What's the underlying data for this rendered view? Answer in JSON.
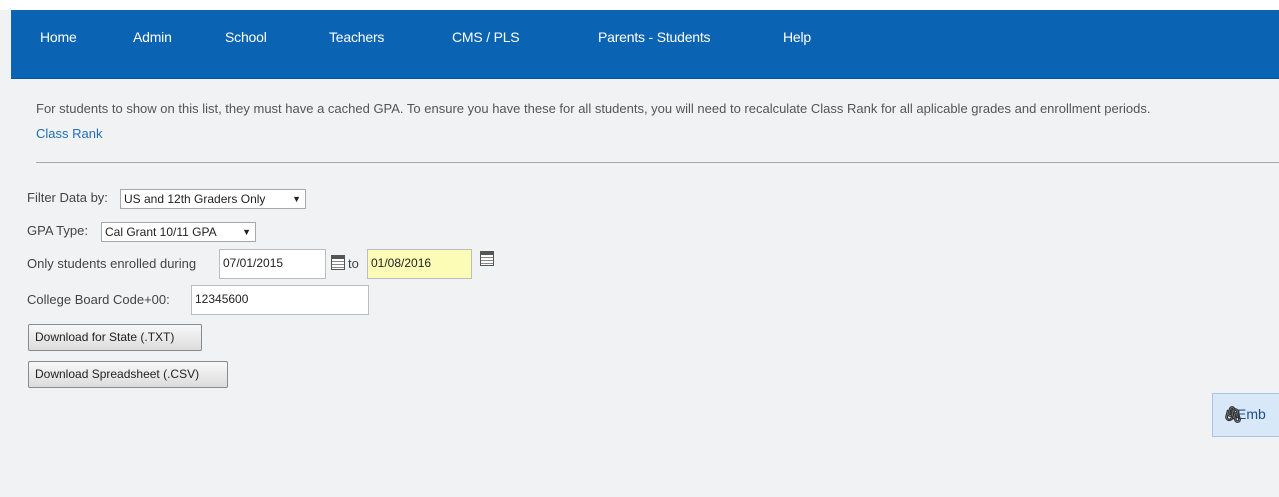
{
  "nav": {
    "items": [
      {
        "label": "Home"
      },
      {
        "label": "Admin"
      },
      {
        "label": "School"
      },
      {
        "label": "Teachers"
      },
      {
        "label": "CMS / PLS"
      },
      {
        "label": "Parents - Students"
      },
      {
        "label": "Help"
      }
    ]
  },
  "notice": {
    "text": "For students to show on this list, they must have a cached GPA. To ensure you have these for all students, you will need to recalculate Class Rank for all aplicable grades and enrollment periods.",
    "link_label": "Class Rank"
  },
  "filters": {
    "filter_label": "Filter Data by:",
    "filter_value": "US and 12th Graders Only",
    "gpa_type_label": "GPA Type:",
    "gpa_type_value": "Cal Grant 10/11 GPA",
    "enrolled_label": "Only students enrolled during",
    "start_date": "07/01/2015",
    "to_label": "to",
    "end_date": "01/08/2016",
    "college_board_label": "College Board Code+00:",
    "college_board_value": "12345600"
  },
  "buttons": {
    "download_state": "Download for State (.TXT)",
    "download_csv": "Download Spreadsheet (.CSV)",
    "embed": "Emb"
  },
  "icons": {
    "dropdown_arrow": "▼",
    "paperclip": "paperclip-icon",
    "calendar": "calendar-icon"
  },
  "colors": {
    "nav_bg": "#0b64b3",
    "link": "#1f6fb8",
    "highlight_input": "#fcfcb7"
  }
}
